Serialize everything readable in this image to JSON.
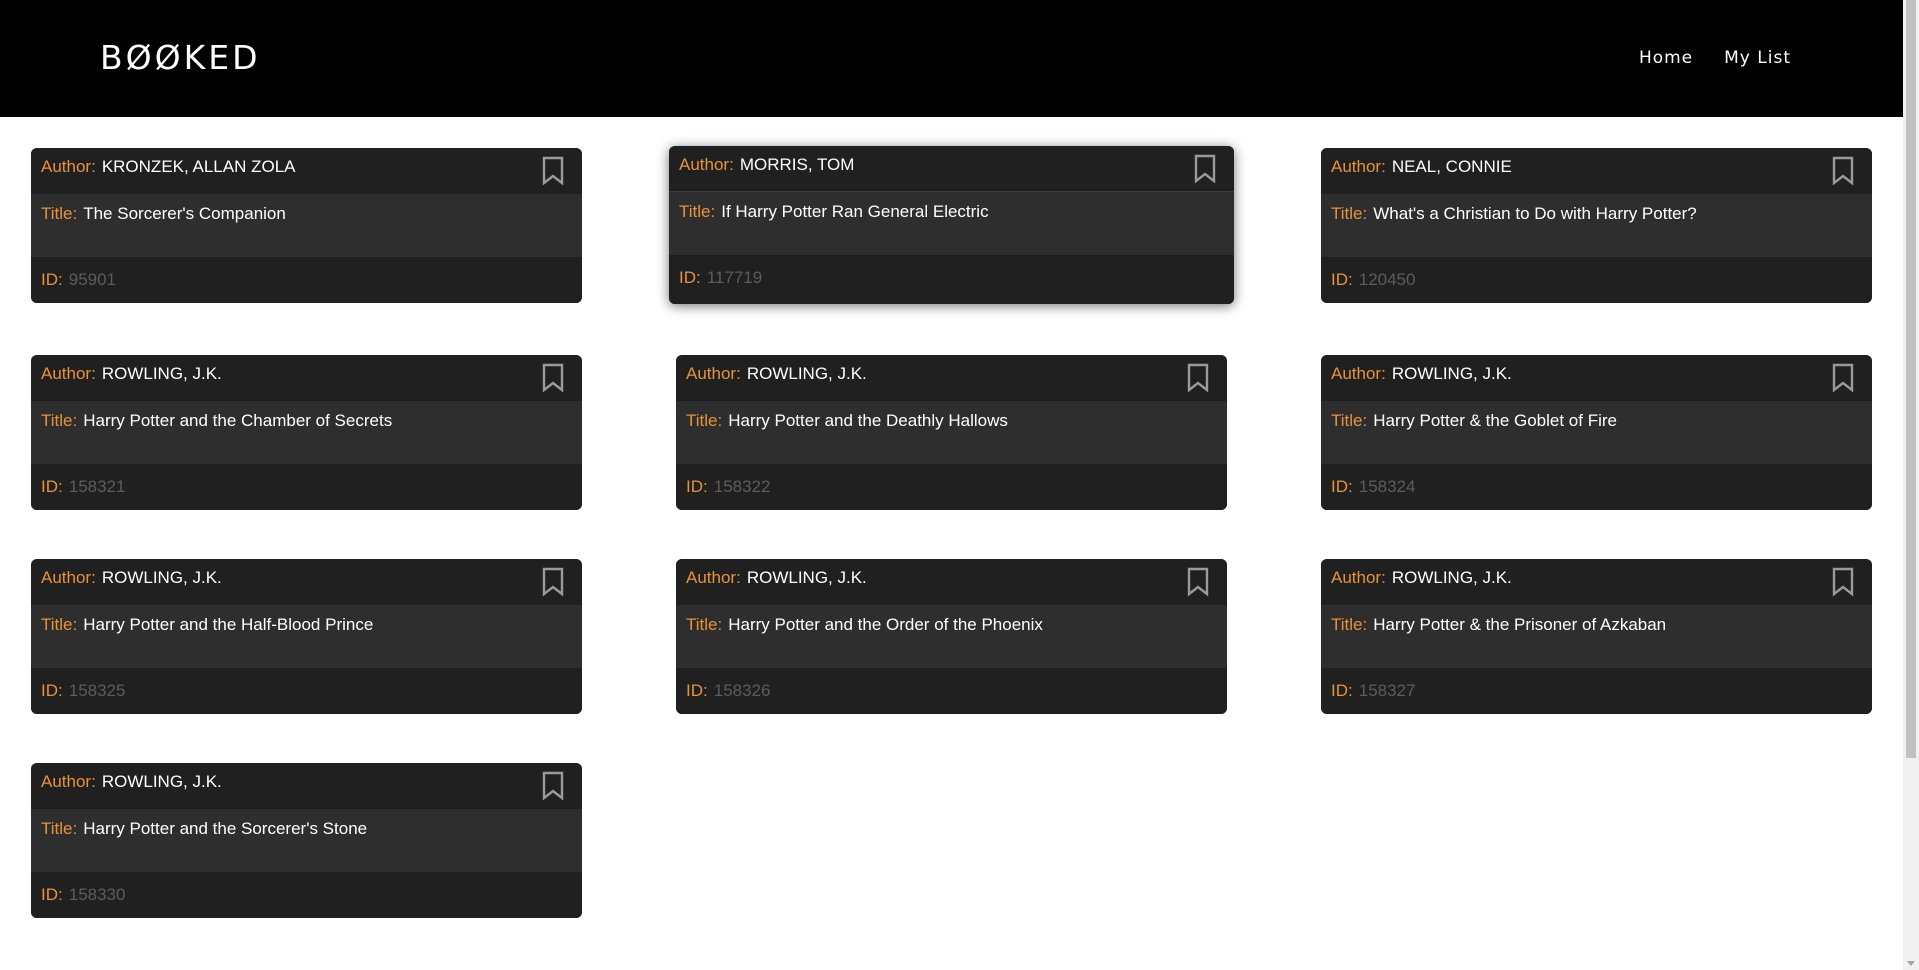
{
  "header": {
    "brand": "BØØKED",
    "nav": [
      {
        "label": "Home"
      },
      {
        "label": "My List"
      }
    ]
  },
  "labels": {
    "author": "Author:",
    "title": "Title:",
    "id": "ID:"
  },
  "books": [
    {
      "author": "KRONZEK, ALLAN ZOLA",
      "title": "The Sorcerer's Companion",
      "id": "95901"
    },
    {
      "author": "MORRIS, TOM",
      "title": "If Harry Potter Ran General Electric",
      "id": "117719"
    },
    {
      "author": "NEAL, CONNIE",
      "title": "What's a Christian to Do with Harry Potter?",
      "id": "120450"
    },
    {
      "author": "ROWLING, J.K.",
      "title": "Harry Potter and the Chamber of Secrets",
      "id": "158321"
    },
    {
      "author": "ROWLING, J.K.",
      "title": "Harry Potter and the Deathly Hallows",
      "id": "158322"
    },
    {
      "author": "ROWLING, J.K.",
      "title": "Harry Potter & the Goblet of Fire",
      "id": "158324"
    },
    {
      "author": "ROWLING, J.K.",
      "title": "Harry Potter and the Half-Blood Prince",
      "id": "158325"
    },
    {
      "author": "ROWLING, J.K.",
      "title": "Harry Potter and the Order of the Phoenix",
      "id": "158326"
    },
    {
      "author": "ROWLING, J.K.",
      "title": "Harry Potter & the Prisoner of Azkaban",
      "id": "158327"
    },
    {
      "author": "ROWLING, J.K.",
      "title": "Harry Potter and the Sorcerer's Stone",
      "id": "158330"
    }
  ],
  "colors": {
    "label_accent": "#e8923a",
    "card_bg": "#202020",
    "card_body_bg": "#2e2e2e"
  },
  "icons": {
    "bookmark": "bookmark-icon"
  }
}
